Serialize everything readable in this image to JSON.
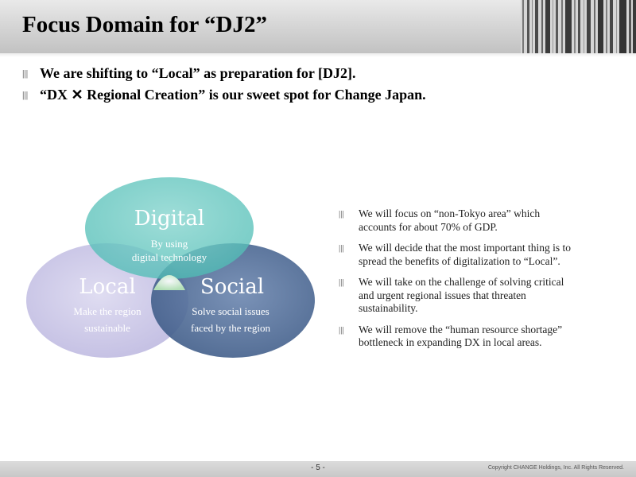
{
  "header": {
    "title": "Focus Domain for “DJ2”"
  },
  "bullet_mark": "|||",
  "top_bullets": [
    "We are shifting to “Local” as preparation for [DJ2].",
    "“DX ✕ Regional Creation” is our sweet spot for Change Japan."
  ],
  "venn": {
    "digital": {
      "title": "Digital",
      "lines": [
        "By using",
        "digital technology"
      ]
    },
    "local": {
      "title": "Local",
      "lines": [
        "Make the region",
        "sustainable"
      ]
    },
    "social": {
      "title": "Social",
      "lines": [
        "Solve social issues",
        "faced by the region"
      ]
    },
    "colors": {
      "digital": "#4fbdb5",
      "local": "#c9c5e6",
      "social": "#4e6b95"
    }
  },
  "right_bullets": [
    [
      "We will focus on “non-Tokyo area” which",
      "accounts for about 70% of GDP."
    ],
    [
      "We will decide that the most important thing is to",
      "spread the benefits of digitalization to “Local”."
    ],
    [
      "We will take on the challenge of solving critical",
      "and urgent regional issues that threaten",
      "sustainability."
    ],
    [
      "We will remove the “human resource shortage”",
      "bottleneck in expanding DX in local areas."
    ]
  ],
  "footer": {
    "page": "- 5 -",
    "copyright": "Copyright CHANGE Holdings, Inc. All Rights Reserved."
  }
}
